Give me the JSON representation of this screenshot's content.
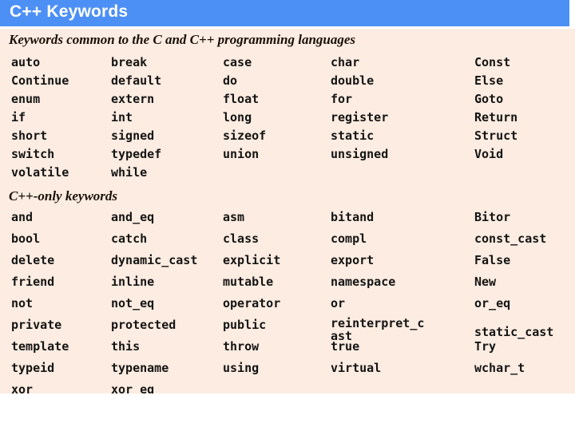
{
  "slide": {
    "title": "C++ Keywords",
    "title_bar_color": "#4d90f5",
    "title_text_color": "#ffffff",
    "panel_color": "#fcece1",
    "page_background": "#ffffff"
  },
  "sections": [
    {
      "heading": "Keywords common to the C and C++ programming languages",
      "rows": [
        [
          "auto",
          "break",
          "case",
          "char",
          "Const"
        ],
        [
          "Continue",
          "default",
          "do",
          "double",
          "Else"
        ],
        [
          "enum",
          "extern",
          "float",
          "for",
          "Goto"
        ],
        [
          "if",
          "int",
          "long",
          "register",
          "Return"
        ],
        [
          "short",
          "signed",
          "sizeof",
          "static",
          "Struct"
        ],
        [
          "switch",
          "typedef",
          "union",
          "unsigned",
          "Void"
        ],
        [
          "volatile",
          "while",
          "",
          "",
          ""
        ]
      ]
    },
    {
      "heading": "C++-only keywords",
      "rows": [
        [
          "and",
          "and_eq",
          "asm",
          "bitand",
          "Bitor"
        ],
        [
          "bool",
          "catch",
          "class",
          "compl",
          "const_cast"
        ],
        [
          "delete",
          "dynamic_cast",
          "explicit",
          "export",
          "False"
        ],
        [
          "friend",
          "inline",
          "mutable",
          "namespace",
          "New"
        ],
        [
          "not",
          "not_eq",
          "operator",
          "or",
          "or_eq"
        ],
        [
          "private",
          "protected",
          "public",
          "reinterpret_cast",
          "static_cast"
        ],
        [
          "template",
          "this",
          "throw",
          "true",
          "Try"
        ],
        [
          "typeid",
          "typename",
          "using",
          "virtual",
          "wchar_t"
        ],
        [
          "xor",
          "xor_eq",
          "",
          "",
          ""
        ]
      ]
    }
  ]
}
